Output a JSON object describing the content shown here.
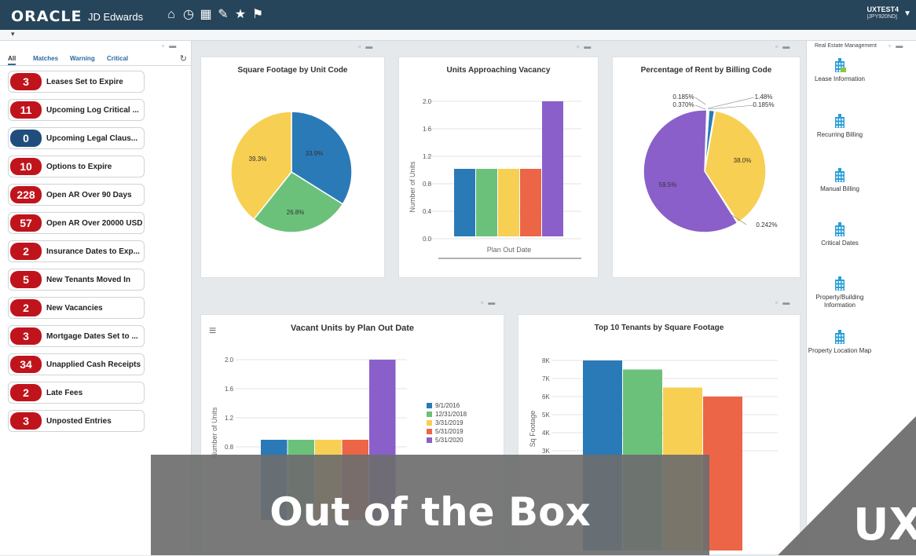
{
  "header": {
    "brand": "ORACLE",
    "product": "JD Edwards",
    "user": "UXTEST4",
    "env": "[JPY920ND]",
    "nav_icons": [
      "home-icon",
      "history-icon",
      "chart-icon",
      "edit-icon",
      "star-icon",
      "flag-icon"
    ]
  },
  "left": {
    "tabs": [
      "All",
      "Matches",
      "Warning",
      "Critical"
    ],
    "alerts": [
      {
        "count": "3",
        "label": "Leases Set to Expire",
        "color": "#c0141c"
      },
      {
        "count": "11",
        "label": "Upcoming Log Critical ...",
        "color": "#c0141c"
      },
      {
        "count": "0",
        "label": "Upcoming Legal Claus...",
        "color": "#1f4e7d"
      },
      {
        "count": "10",
        "label": "Options to Expire",
        "color": "#c0141c"
      },
      {
        "count": "228",
        "label": "Open AR Over 90 Days",
        "color": "#c0141c"
      },
      {
        "count": "57",
        "label": "Open AR Over 20000 USD",
        "color": "#c0141c"
      },
      {
        "count": "2",
        "label": "Insurance Dates to Exp...",
        "color": "#c0141c"
      },
      {
        "count": "5",
        "label": "New Tenants Moved In",
        "color": "#c0141c"
      },
      {
        "count": "2",
        "label": "New Vacancies",
        "color": "#c0141c"
      },
      {
        "count": "3",
        "label": "Mortgage Dates Set to ...",
        "color": "#c0141c"
      },
      {
        "count": "34",
        "label": "Unapplied Cash Receipts",
        "color": "#c0141c"
      },
      {
        "count": "2",
        "label": "Late Fees",
        "color": "#c0141c"
      },
      {
        "count": "3",
        "label": "Unposted Entries",
        "color": "#c0141c"
      }
    ]
  },
  "colors": {
    "blue": "#2a7ab8",
    "green": "#6cc17a",
    "yellow": "#f7cf52",
    "red": "#ec6547",
    "purple": "#8a5fc9"
  },
  "chart_data": [
    {
      "type": "pie",
      "title": "Square Footage by Unit Code",
      "slices": [
        {
          "value": 33.9,
          "label": "33.9%",
          "color": "#2a7ab8"
        },
        {
          "value": 26.8,
          "label": "26.8%",
          "color": "#6cc17a"
        },
        {
          "value": 39.3,
          "label": "39.3%",
          "color": "#f7cf52"
        }
      ]
    },
    {
      "type": "bar",
      "title": "Units Approaching Vacancy",
      "ylabel": "Number of Units",
      "xlabel": "Plan Out Date",
      "yticks": [
        "2.0",
        "1.6",
        "1.2",
        "0.8",
        "0.4",
        "0.0"
      ],
      "ylim": [
        0,
        2
      ],
      "values": [
        1,
        1,
        1,
        1,
        2
      ]
    },
    {
      "type": "pie",
      "title": "Percentage of Rent by Billing Code",
      "slices": [
        {
          "value": 0.185,
          "label": "0.185%",
          "color": "#2a7ab8"
        },
        {
          "value": 0.37,
          "label": "0.370%",
          "color": "#6cc17a"
        },
        {
          "value": 1.48,
          "label": "1.48%",
          "color": "#2a7ab8"
        },
        {
          "value": 0.185,
          "label": "0.185%",
          "color": "#ec6547"
        },
        {
          "value": 38.0,
          "label": "38.0%",
          "color": "#f7cf52"
        },
        {
          "value": 0.242,
          "label": "0.242%",
          "color": "#6cc17a"
        },
        {
          "value": 59.5,
          "label": "59.5%",
          "color": "#8a5fc9"
        }
      ]
    },
    {
      "type": "bar",
      "title": "Vacant Units by Plan Out Date",
      "ylabel": "Number of Units",
      "yticks": [
        "2.0",
        "1.6",
        "1.2",
        "0.8"
      ],
      "ylim": [
        0,
        2
      ],
      "categories": [
        "9/1/2016",
        "12/31/2018",
        "3/31/2019",
        "5/31/2019",
        "5/31/2020"
      ],
      "values": [
        1,
        1,
        1,
        1,
        2
      ]
    },
    {
      "type": "bar",
      "title": "Top 10 Tenants by Square Footage",
      "ylabel": "Sq Footage",
      "yticks": [
        "8K",
        "7K",
        "6K",
        "5K",
        "4K",
        "3K"
      ],
      "values": [
        8000,
        7500,
        6500,
        6000
      ]
    }
  ],
  "right": {
    "title": "Real Estate Management",
    "items": [
      "Lease Information",
      "Recurring Billing",
      "Manual Billing",
      "Critical Dates",
      "Property/Building Information",
      "Property Location Map"
    ]
  },
  "overlay": {
    "left_text": "Out of the Box",
    "right_text": "UX"
  }
}
